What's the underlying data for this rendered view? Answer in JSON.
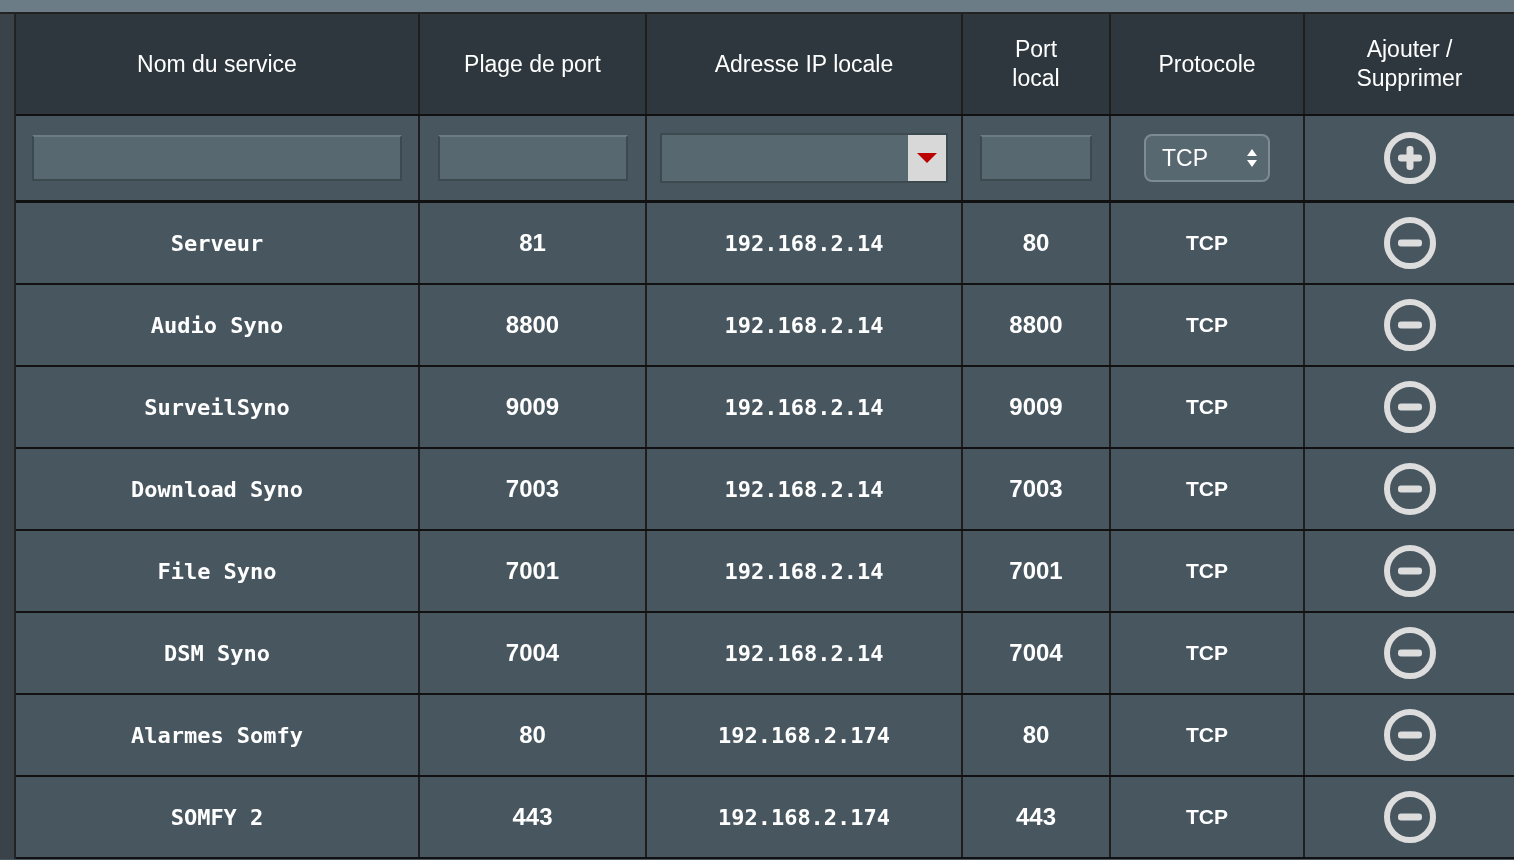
{
  "table": {
    "columns": [
      "Nom du service",
      "Plage de port",
      "Adresse IP locale",
      "Port local",
      "Protocole",
      "Ajouter / Supprimer"
    ],
    "new_entry": {
      "protocol": "TCP"
    },
    "rows": [
      {
        "service": "Serveur",
        "port_range": "81",
        "local_ip": "192.168.2.14",
        "local_port": "80",
        "protocol": "TCP"
      },
      {
        "service": "Audio Syno",
        "port_range": "8800",
        "local_ip": "192.168.2.14",
        "local_port": "8800",
        "protocol": "TCP"
      },
      {
        "service": "SurveilSyno",
        "port_range": "9009",
        "local_ip": "192.168.2.14",
        "local_port": "9009",
        "protocol": "TCP"
      },
      {
        "service": "Download Syno",
        "port_range": "7003",
        "local_ip": "192.168.2.14",
        "local_port": "7003",
        "protocol": "TCP"
      },
      {
        "service": "File Syno",
        "port_range": "7001",
        "local_ip": "192.168.2.14",
        "local_port": "7001",
        "protocol": "TCP"
      },
      {
        "service": "DSM Syno",
        "port_range": "7004",
        "local_ip": "192.168.2.14",
        "local_port": "7004",
        "protocol": "TCP"
      },
      {
        "service": "Alarmes Somfy",
        "port_range": "80",
        "local_ip": "192.168.2.174",
        "local_port": "80",
        "protocol": "TCP"
      },
      {
        "service": "SOMFY 2",
        "port_range": "443",
        "local_ip": "192.168.2.174",
        "local_port": "443",
        "protocol": "TCP"
      }
    ]
  }
}
